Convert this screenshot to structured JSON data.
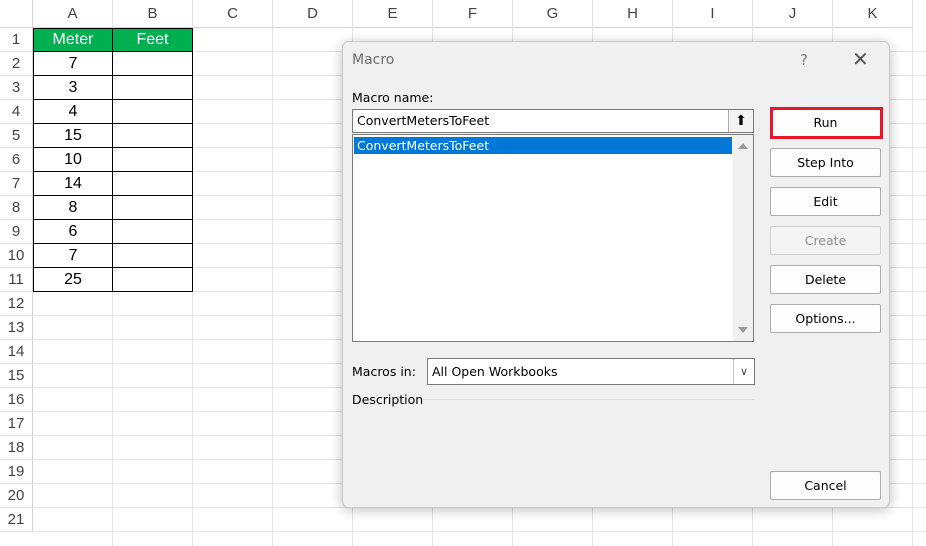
{
  "sheet": {
    "columns": [
      "A",
      "B",
      "C",
      "D",
      "E",
      "F",
      "G",
      "H",
      "I",
      "J",
      "K"
    ],
    "rows": [
      "1",
      "2",
      "3",
      "4",
      "5",
      "6",
      "7",
      "8",
      "9",
      "10",
      "11",
      "12",
      "13",
      "14",
      "15",
      "16",
      "17",
      "18",
      "19",
      "20",
      "21"
    ],
    "table_headers": [
      "Meter",
      "Feet"
    ],
    "meter_values": [
      "7",
      "3",
      "4",
      "15",
      "10",
      "14",
      "8",
      "6",
      "7",
      "25"
    ],
    "header_color": "#00b050"
  },
  "dialog": {
    "title": "Macro",
    "help": "?",
    "close": "✕",
    "macro_name_label": "Macro name:",
    "macro_name_value": "ConvertMetersToFeet",
    "upload_icon": "⬆",
    "macros": [
      "ConvertMetersToFeet"
    ],
    "macros_in_label": "Macros in:",
    "macros_in_value": "All Open Workbooks",
    "description_label": "Description",
    "buttons": {
      "run": "Run",
      "step_into": "Step Into",
      "edit": "Edit",
      "create": "Create",
      "delete": "Delete",
      "options": "Options...",
      "cancel": "Cancel"
    },
    "highlight_color": "#e8162b"
  }
}
